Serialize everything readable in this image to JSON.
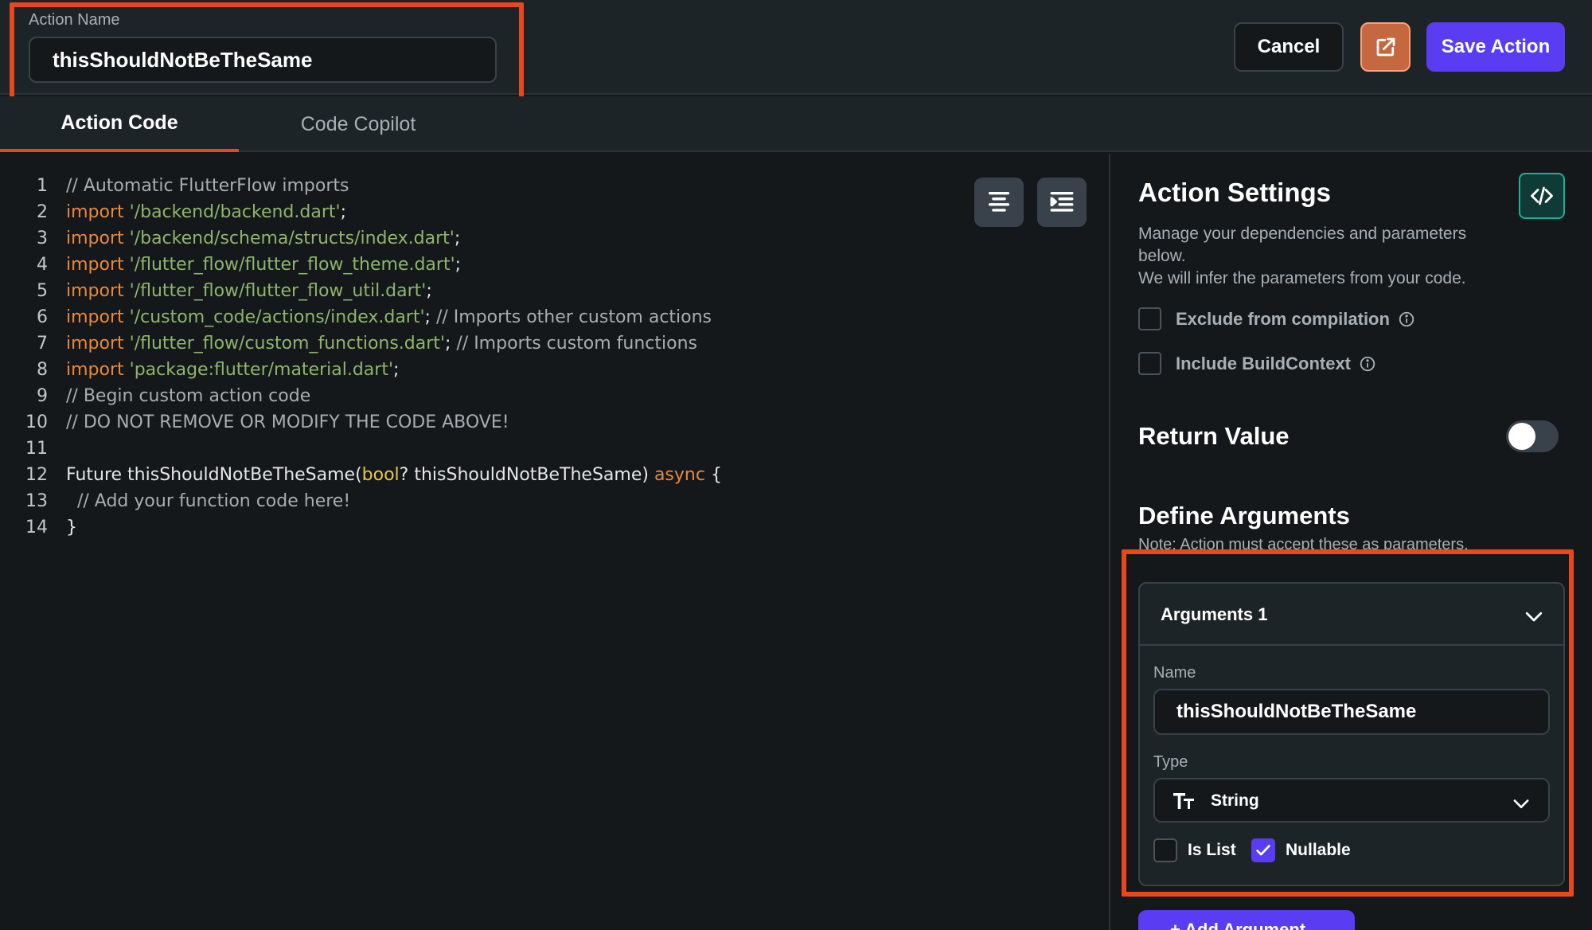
{
  "header": {
    "action_name_label": "Action Name",
    "action_name_value": "thisShouldNotBeTheSame",
    "cancel_label": "Cancel",
    "save_label": "Save Action"
  },
  "tabs": [
    {
      "label": "Action Code",
      "active": true
    },
    {
      "label": "Code Copilot",
      "active": false
    }
  ],
  "code_lines": [
    {
      "n": "1",
      "parts": [
        {
          "t": "// Automatic FlutterFlow imports",
          "c": "cmt"
        }
      ]
    },
    {
      "n": "2",
      "parts": [
        {
          "t": "import ",
          "c": "kw"
        },
        {
          "t": "'/backend/backend.dart'",
          "c": "str"
        },
        {
          "t": ";",
          "c": "pl"
        }
      ]
    },
    {
      "n": "3",
      "parts": [
        {
          "t": "import ",
          "c": "kw"
        },
        {
          "t": "'/backend/schema/structs/index.dart'",
          "c": "str"
        },
        {
          "t": ";",
          "c": "pl"
        }
      ]
    },
    {
      "n": "4",
      "parts": [
        {
          "t": "import ",
          "c": "kw"
        },
        {
          "t": "'/flutter_flow/flutter_flow_theme.dart'",
          "c": "str"
        },
        {
          "t": ";",
          "c": "pl"
        }
      ]
    },
    {
      "n": "5",
      "parts": [
        {
          "t": "import ",
          "c": "kw"
        },
        {
          "t": "'/flutter_flow/flutter_flow_util.dart'",
          "c": "str"
        },
        {
          "t": ";",
          "c": "pl"
        }
      ]
    },
    {
      "n": "6",
      "parts": [
        {
          "t": "import ",
          "c": "kw"
        },
        {
          "t": "'/custom_code/actions/index.dart'",
          "c": "str"
        },
        {
          "t": "; ",
          "c": "pl"
        },
        {
          "t": "// Imports other custom actions",
          "c": "cmt"
        }
      ]
    },
    {
      "n": "7",
      "parts": [
        {
          "t": "import ",
          "c": "kw"
        },
        {
          "t": "'/flutter_flow/custom_functions.dart'",
          "c": "str"
        },
        {
          "t": "; ",
          "c": "pl"
        },
        {
          "t": "// Imports custom functions",
          "c": "cmt"
        }
      ]
    },
    {
      "n": "8",
      "parts": [
        {
          "t": "import ",
          "c": "kw"
        },
        {
          "t": "'package:flutter/material.dart'",
          "c": "str"
        },
        {
          "t": ";",
          "c": "pl"
        }
      ]
    },
    {
      "n": "9",
      "parts": [
        {
          "t": "// Begin custom action code",
          "c": "cmt"
        }
      ]
    },
    {
      "n": "10",
      "parts": [
        {
          "t": "// DO NOT REMOVE OR MODIFY THE CODE ABOVE!",
          "c": "cmt"
        }
      ]
    },
    {
      "n": "11",
      "parts": []
    },
    {
      "n": "12",
      "parts": [
        {
          "t": "Future thisShouldNotBeTheSame(",
          "c": "pl"
        },
        {
          "t": "bool",
          "c": "ty"
        },
        {
          "t": "? thisShouldNotBeTheSame) ",
          "c": "pl"
        },
        {
          "t": "async",
          "c": "kw"
        },
        {
          "t": " {",
          "c": "pl"
        }
      ]
    },
    {
      "n": "13",
      "parts": [
        {
          "t": "  // Add your function code here!",
          "c": "cmt"
        }
      ]
    },
    {
      "n": "14",
      "parts": [
        {
          "t": "}",
          "c": "pl"
        }
      ]
    }
  ],
  "settings": {
    "title": "Action Settings",
    "desc_line1": "Manage your dependencies and parameters below.",
    "desc_line2": "We will infer the parameters from your code.",
    "exclude_label": "Exclude from compilation",
    "build_context_label": "Include BuildContext",
    "return_value_label": "Return Value",
    "return_value_on": false,
    "define_args_title": "Define Arguments",
    "define_args_note": "Note: Action must accept these as parameters.",
    "argument": {
      "header": "Arguments 1",
      "name_label": "Name",
      "name_value": "thisShouldNotBeTheSame",
      "type_label": "Type",
      "type_value": "String",
      "is_list_label": "Is List",
      "is_list_checked": false,
      "nullable_label": "Nullable",
      "nullable_checked": true
    },
    "add_argument_label": "+ Add Argument"
  },
  "icons": {
    "open": "external-link-icon",
    "format": "align-center-icon",
    "indent": "indent-icon",
    "code": "code-brackets-icon",
    "info": "info-icon",
    "chevron": "chevron-down-icon",
    "type": "text-type-icon",
    "check": "check-icon"
  },
  "colors": {
    "accent": "#5a3cf2",
    "highlight": "#e8481c",
    "keyword": "#e9893a",
    "string": "#8fb56c",
    "type": "#e6c84a",
    "teal": "#1fae92"
  }
}
